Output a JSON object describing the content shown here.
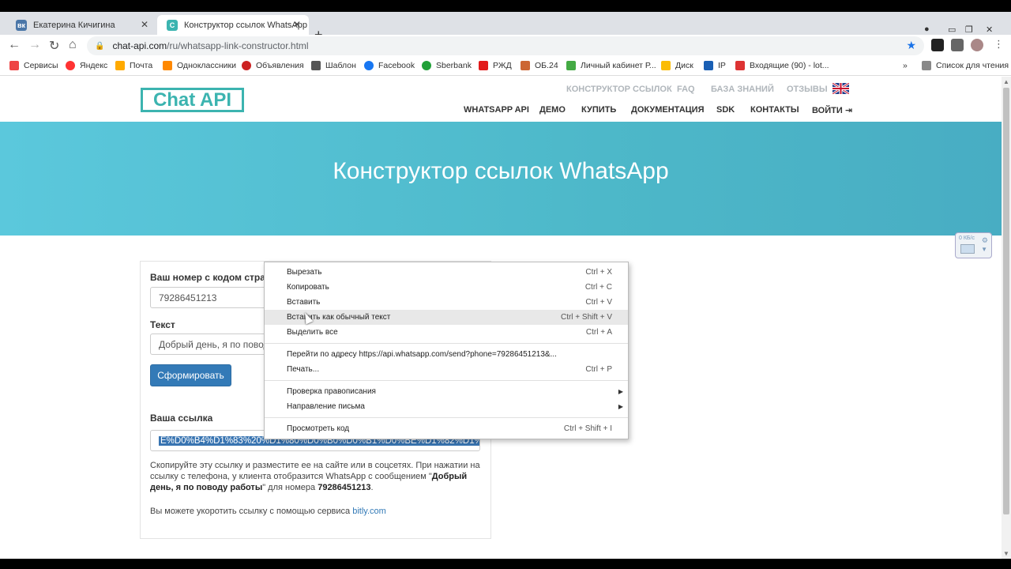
{
  "browser": {
    "tabs": [
      {
        "title": "Екатерина Кичигина",
        "favicon": "vk-icon"
      },
      {
        "title": "Конструктор ссылок WhatsApp",
        "favicon": "chatapi-icon"
      }
    ],
    "url_host": "chat-api.com",
    "url_path": "/ru/whatsapp-link-constructor.html",
    "bookmarks": [
      "Сервисы",
      "Яндекс",
      "Почта",
      "Одноклассники",
      "Объявления",
      "Шаблон",
      "Facebook",
      "Sberbank",
      "РЖД",
      "ОБ.24",
      "Личный кабинет Р...",
      "Диск",
      "IP",
      "Входящие (90) - lot..."
    ],
    "more_bookmarks": "»",
    "reading_list": "Список для чтения"
  },
  "site": {
    "logo": "Chat API",
    "top_nav": [
      "КОНСТРУКТОР ССЫЛОК",
      "FAQ",
      "БАЗА ЗНАНИЙ",
      "ОТЗЫВЫ"
    ],
    "main_nav": [
      "WHATSAPP API",
      "ДЕМО",
      "КУПИТЬ",
      "ДОКУМЕНТАЦИЯ",
      "SDK",
      "КОНТАКТЫ",
      "ВОЙТИ"
    ],
    "hero_title": "Конструктор ссылок WhatsApp"
  },
  "form": {
    "phone_label": "Ваш номер с кодом страны",
    "phone_value": "79286451213",
    "text_label": "Текст",
    "text_value": "Добрый день, я по повод",
    "submit_label": "Сформировать",
    "link_label": "Ваша ссылка",
    "link_value": "E%D0%B4%D1%83%20%D1%80%D0%B0%D0%B1%D0%BE%D1%82%D1%8B",
    "desc_1": "Скопируйте эту ссылку и разместите ее на сайте или в соцсетях. При нажатии на ссылку с телефона, у клиента отобразится WhatsApp с сообщением \"",
    "desc_msg": "Добрый день, я по поводу работы",
    "desc_2": "\" для номера ",
    "desc_number": "79286451213",
    "desc_3": ".",
    "shorten_text": "Вы можете укоротить ссылку с помощью сервиса ",
    "shorten_link": "bitly.com"
  },
  "context_menu": {
    "items": [
      {
        "label": "Вырезать",
        "shortcut": "Ctrl + X"
      },
      {
        "label": "Копировать",
        "shortcut": "Ctrl + C"
      },
      {
        "label": "Вставить",
        "shortcut": "Ctrl + V"
      },
      {
        "label": "Вставить как обычный текст",
        "shortcut": "Ctrl + Shift + V"
      },
      {
        "label": "Выделить все",
        "shortcut": "Ctrl + A"
      },
      {
        "label": "Перейти по адресу https://api.whatsapp.com/send?phone=79286451213&...",
        "shortcut": ""
      },
      {
        "label": "Печать...",
        "shortcut": "Ctrl + P"
      },
      {
        "label": "Проверка правописания",
        "shortcut": ""
      },
      {
        "label": "Направление письма",
        "shortcut": ""
      },
      {
        "label": "Просмотреть код",
        "shortcut": "Ctrl + Shift + I"
      }
    ]
  },
  "speed_widget": {
    "label": "0 КБ/с"
  },
  "colors": {
    "brand": "#3cb4b0",
    "hero": "#4db8c9",
    "button": "#337ab7"
  }
}
